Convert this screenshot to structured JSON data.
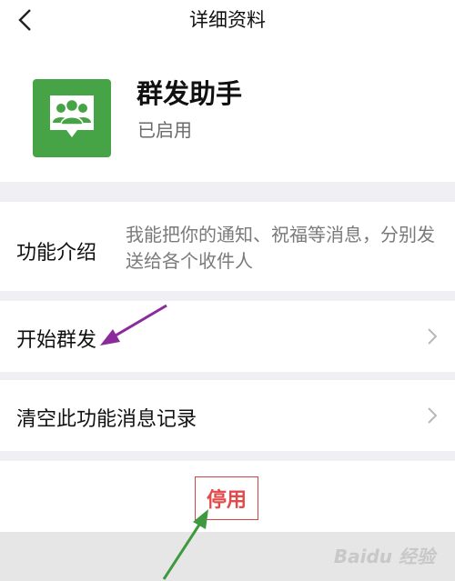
{
  "header": {
    "back_icon": "chevron-left-icon",
    "title": "详细资料"
  },
  "app": {
    "icon": "group-chat-icon",
    "icon_color": "#46a446",
    "name": "群发助手",
    "status": "已启用"
  },
  "intro": {
    "label": "功能介绍",
    "text": "我能把你的通知、祝福等消息，分别发送给各个收件人"
  },
  "menu": {
    "start_label": "开始群发",
    "clear_label": "清空此功能消息记录",
    "chevron_icon": "chevron-right-icon"
  },
  "actions": {
    "disable_label": "停用",
    "disable_color": "#e04a4a"
  },
  "annotations": {
    "arrow_1_color": "#8b2a9a",
    "arrow_2_color": "#3f9a3f"
  },
  "watermark": "Baidu 经验"
}
